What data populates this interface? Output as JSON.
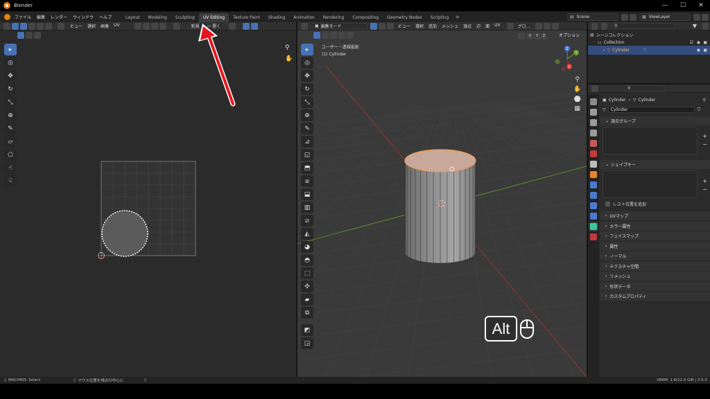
{
  "app": {
    "title": "Blender"
  },
  "menu": [
    "ファイル",
    "編集",
    "レンダー",
    "ウィンドウ",
    "ヘルプ"
  ],
  "workspaces": [
    {
      "label": "Layout",
      "active": false
    },
    {
      "label": "Modeling",
      "active": false
    },
    {
      "label": "Sculpting",
      "active": false
    },
    {
      "label": "UV Editing",
      "active": true
    },
    {
      "label": "Texture Paint",
      "active": false
    },
    {
      "label": "Shading",
      "active": false
    },
    {
      "label": "Animation",
      "active": false
    },
    {
      "label": "Rendering",
      "active": false
    },
    {
      "label": "Compositing",
      "active": false
    },
    {
      "label": "Geometry Nodes",
      "active": false
    },
    {
      "label": "Scripting",
      "active": false
    }
  ],
  "add_workspace": "+",
  "scene": {
    "name": "Scene",
    "view_layer": "ViewLayer"
  },
  "uv_editor": {
    "menus": [
      "ビュー",
      "選択",
      "画像",
      "UV"
    ],
    "new_label": "新規",
    "open_label": "開く"
  },
  "viewport": {
    "mode": "編集モード",
    "menus": [
      "ビュー",
      "選択",
      "追加",
      "メッシュ",
      "頂点",
      "辺",
      "面",
      "UV"
    ],
    "transform": "グロ...",
    "axes": [
      "X",
      "Y",
      "Z"
    ],
    "options": "オプション",
    "overlay_line1": "ユーザー・透視投影",
    "overlay_line2": "(1) Cylinder"
  },
  "key_hint": {
    "key": "Alt"
  },
  "outliner": {
    "title": "シーンコレクション",
    "collection": "Collection",
    "object": "Cylinder"
  },
  "properties": {
    "breadcrumb_obj": "Cylinder",
    "breadcrumb_mesh": "Cylinder",
    "mesh_name": "Cylinder",
    "vertex_groups": "頂点グループ",
    "shape_keys": "シェイプキー",
    "rest_position": "レスト位置を追加",
    "sections": [
      "UVマップ",
      "カラー属性",
      "フェイスマップ",
      "属性",
      "ノーマル",
      "テクスチャ空間",
      "リメッシュ",
      "形状データ",
      "カスタムプロパティ"
    ]
  },
  "status": {
    "left": "MACHIN3: Select",
    "middle": "マウス位置を視点の中心に",
    "right": "VRAM: 1.6/12.0 GiB | 3.5.0"
  },
  "colors": {
    "accent": "#4772b3",
    "arrow": "#e8141b",
    "selected_edge": "#f29a4a",
    "axis_x": "#b03030",
    "axis_y": "#6a9a2a"
  }
}
